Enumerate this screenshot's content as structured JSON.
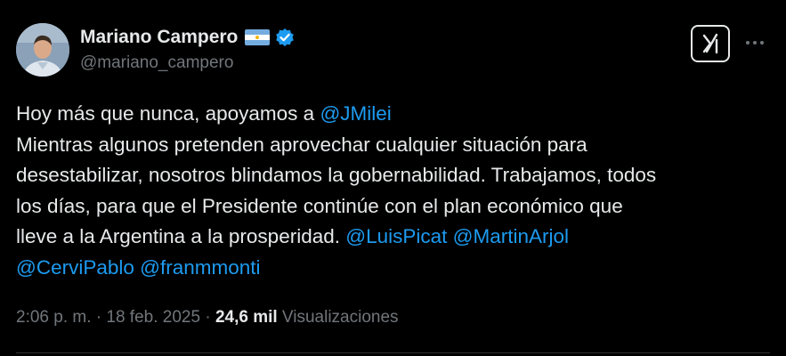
{
  "author": {
    "display_name": "Mariano Campero",
    "handle": "@mariano_campero",
    "flag": "argentina-flag",
    "verified": true
  },
  "header": {
    "grok_icon": "grok-icon",
    "more_icon": "more-options-icon"
  },
  "tweet": {
    "line1_text": "Hoy más que nunca, apoyamos a ",
    "line1_mention": "@JMilei",
    "line2_text": "Mientras algunos pretenden aprovechar cualquier situación para",
    "line3_text": "desestabilizar, nosotros blindamos la gobernabilidad. Trabajamos, todos",
    "line4_text": "los días, para que el Presidente continúe con el plan económico que",
    "line5_text": "lleve a la Argentina a la prosperidad. ",
    "line5_mention1": "@LuisPicat",
    "line5_mention2": "@MartinArjol",
    "line6_mention1": "@CerviPablo",
    "line6_mention2": "@franmmonti"
  },
  "meta": {
    "time": "2:06 p. m.",
    "sep1": " · ",
    "date": "18 feb. 2025",
    "sep2": " · ",
    "views_count": "24,6 mil",
    "views_label": " Visualizaciones"
  },
  "colors": {
    "background": "#000000",
    "text": "#e7e9ea",
    "secondary": "#71767b",
    "link": "#1d9bf0",
    "verified": "#1d9bf0"
  }
}
